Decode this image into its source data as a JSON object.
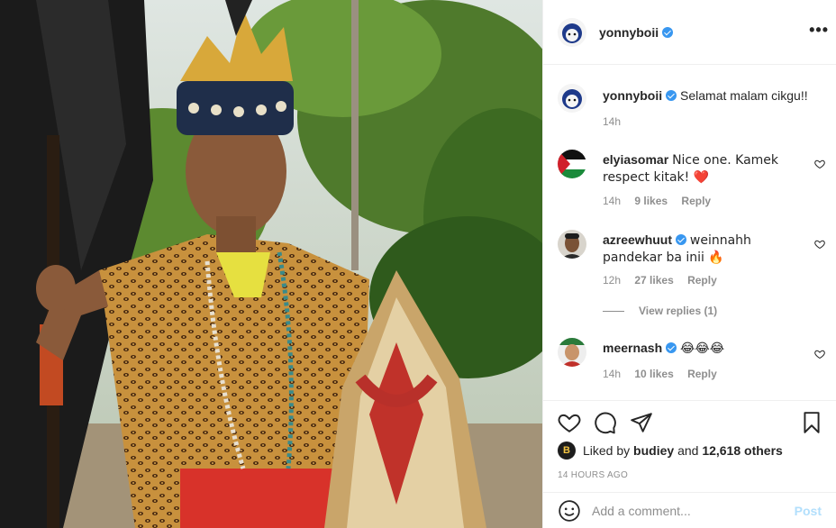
{
  "post": {
    "photo_alt": "Boy in traditional Dayak warrior costume with headdress, spear and shield",
    "author": "yonnyboii",
    "author_verified": true,
    "more_icon": "more-horizontal-icon"
  },
  "caption": {
    "username": "yonnyboii",
    "text": "Selamat malam cikgu!!",
    "time": "14h"
  },
  "comments": [
    {
      "username": "elyiasomar",
      "verified": false,
      "text": "Nice one. Kamek respect kitak! ❤️",
      "time": "14h",
      "likes": "9 likes",
      "reply": "Reply"
    },
    {
      "username": "azreewhuut",
      "verified": true,
      "text": "weinnahh pandekar ba inii 🔥",
      "time": "12h",
      "likes": "27 likes",
      "reply": "Reply",
      "view_replies": "View replies (1)"
    },
    {
      "username": "meernash",
      "verified": true,
      "text": "😂😂😂",
      "time": "14h",
      "likes": "10 likes",
      "reply": "Reply"
    }
  ],
  "liked_by": {
    "prefix": "Liked by",
    "user": "budiey",
    "conj": "and",
    "others": "12,618 others"
  },
  "timestamp": "14 HOURS AGO",
  "add_comment": {
    "placeholder": "Add a comment...",
    "post_label": "Post"
  },
  "colors": {
    "verified": "#3897f0",
    "text": "#262626",
    "muted": "#8e8e8e",
    "post_disabled": "#b2dffc",
    "heart_red": "#ed4956"
  }
}
